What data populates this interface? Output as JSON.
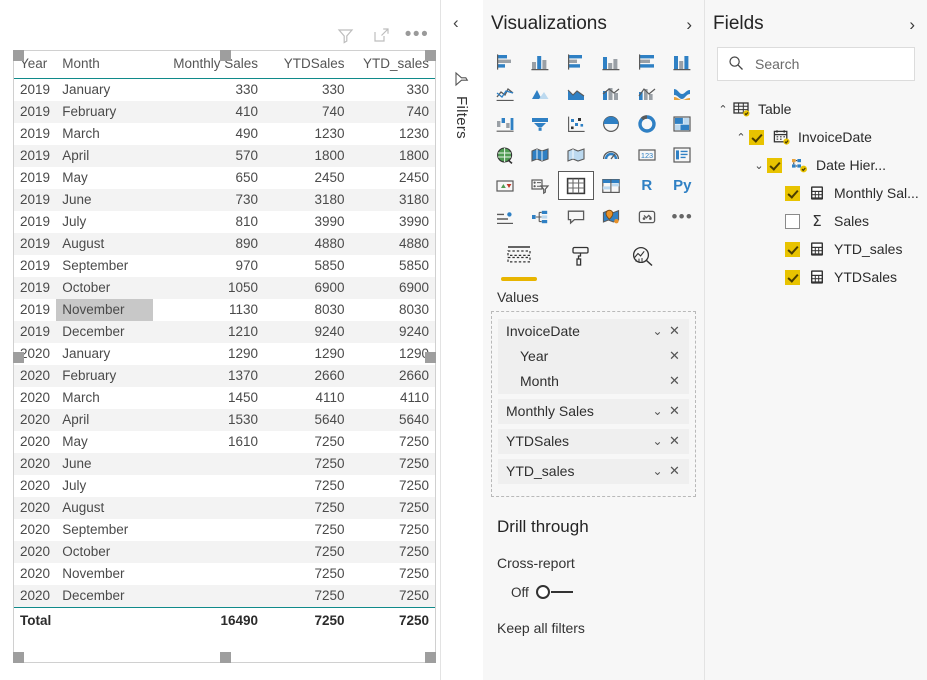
{
  "canvas": {
    "toolbar": [
      {
        "name": "filter-icon",
        "title": "Filters"
      },
      {
        "name": "focus-mode-icon",
        "title": "Focus mode"
      },
      {
        "name": "more-options-icon",
        "title": "More options",
        "glyph": "•••"
      }
    ]
  },
  "table_visual": {
    "columns": [
      {
        "key": "year",
        "label": "Year",
        "align": "left"
      },
      {
        "key": "month",
        "label": "Month",
        "align": "left"
      },
      {
        "key": "monthly_sales",
        "label": "Monthly Sales",
        "align": "right"
      },
      {
        "key": "ytdsales",
        "label": "YTDSales",
        "align": "right"
      },
      {
        "key": "ytd_sales",
        "label": "YTD_sales",
        "align": "right"
      }
    ],
    "rows": [
      {
        "year": "2019",
        "month": "January",
        "monthly_sales": "330",
        "ytdsales": "330",
        "ytd_sales": "330"
      },
      {
        "year": "2019",
        "month": "February",
        "monthly_sales": "410",
        "ytdsales": "740",
        "ytd_sales": "740"
      },
      {
        "year": "2019",
        "month": "March",
        "monthly_sales": "490",
        "ytdsales": "1230",
        "ytd_sales": "1230"
      },
      {
        "year": "2019",
        "month": "April",
        "monthly_sales": "570",
        "ytdsales": "1800",
        "ytd_sales": "1800"
      },
      {
        "year": "2019",
        "month": "May",
        "monthly_sales": "650",
        "ytdsales": "2450",
        "ytd_sales": "2450"
      },
      {
        "year": "2019",
        "month": "June",
        "monthly_sales": "730",
        "ytdsales": "3180",
        "ytd_sales": "3180"
      },
      {
        "year": "2019",
        "month": "July",
        "monthly_sales": "810",
        "ytdsales": "3990",
        "ytd_sales": "3990"
      },
      {
        "year": "2019",
        "month": "August",
        "monthly_sales": "890",
        "ytdsales": "4880",
        "ytd_sales": "4880"
      },
      {
        "year": "2019",
        "month": "September",
        "monthly_sales": "970",
        "ytdsales": "5850",
        "ytd_sales": "5850"
      },
      {
        "year": "2019",
        "month": "October",
        "monthly_sales": "1050",
        "ytdsales": "6900",
        "ytd_sales": "6900"
      },
      {
        "year": "2019",
        "month": "November",
        "monthly_sales": "1130",
        "ytdsales": "8030",
        "ytd_sales": "8030",
        "hover": true
      },
      {
        "year": "2019",
        "month": "December",
        "monthly_sales": "1210",
        "ytdsales": "9240",
        "ytd_sales": "9240"
      },
      {
        "year": "2020",
        "month": "January",
        "monthly_sales": "1290",
        "ytdsales": "1290",
        "ytd_sales": "1290"
      },
      {
        "year": "2020",
        "month": "February",
        "monthly_sales": "1370",
        "ytdsales": "2660",
        "ytd_sales": "2660"
      },
      {
        "year": "2020",
        "month": "March",
        "monthly_sales": "1450",
        "ytdsales": "4110",
        "ytd_sales": "4110"
      },
      {
        "year": "2020",
        "month": "April",
        "monthly_sales": "1530",
        "ytdsales": "5640",
        "ytd_sales": "5640"
      },
      {
        "year": "2020",
        "month": "May",
        "monthly_sales": "1610",
        "ytdsales": "7250",
        "ytd_sales": "7250"
      },
      {
        "year": "2020",
        "month": "June",
        "monthly_sales": "",
        "ytdsales": "7250",
        "ytd_sales": "7250"
      },
      {
        "year": "2020",
        "month": "July",
        "monthly_sales": "",
        "ytdsales": "7250",
        "ytd_sales": "7250"
      },
      {
        "year": "2020",
        "month": "August",
        "monthly_sales": "",
        "ytdsales": "7250",
        "ytd_sales": "7250"
      },
      {
        "year": "2020",
        "month": "September",
        "monthly_sales": "",
        "ytdsales": "7250",
        "ytd_sales": "7250"
      },
      {
        "year": "2020",
        "month": "October",
        "monthly_sales": "",
        "ytdsales": "7250",
        "ytd_sales": "7250"
      },
      {
        "year": "2020",
        "month": "November",
        "monthly_sales": "",
        "ytdsales": "7250",
        "ytd_sales": "7250"
      },
      {
        "year": "2020",
        "month": "December",
        "monthly_sales": "",
        "ytdsales": "7250",
        "ytd_sales": "7250"
      }
    ],
    "total": {
      "year": "Total",
      "month": "",
      "monthly_sales": "16490",
      "ytdsales": "7250",
      "ytd_sales": "7250"
    },
    "accent_color": "#108a8a",
    "alt_row_color": "#f3f3f3",
    "hover_cell_color": "#c8c8c8"
  },
  "filters_pane": {
    "label": "Filters",
    "collapse_glyph": "‹"
  },
  "visualizations_pane": {
    "title": "Visualizations",
    "expand_glyph": "›",
    "icons": [
      {
        "name": "stacked-bar-chart-icon"
      },
      {
        "name": "stacked-column-chart-icon"
      },
      {
        "name": "clustered-bar-chart-icon"
      },
      {
        "name": "clustered-column-chart-icon"
      },
      {
        "name": "100-stacked-bar-chart-icon"
      },
      {
        "name": "100-stacked-column-chart-icon"
      },
      {
        "name": "line-chart-icon"
      },
      {
        "name": "area-chart-icon"
      },
      {
        "name": "stacked-area-chart-icon"
      },
      {
        "name": "line-stacked-column-chart-icon"
      },
      {
        "name": "line-clustered-column-chart-icon"
      },
      {
        "name": "ribbon-chart-icon"
      },
      {
        "name": "waterfall-chart-icon"
      },
      {
        "name": "funnel-chart-icon"
      },
      {
        "name": "scatter-chart-icon"
      },
      {
        "name": "pie-chart-icon"
      },
      {
        "name": "donut-chart-icon"
      },
      {
        "name": "treemap-icon"
      },
      {
        "name": "map-icon"
      },
      {
        "name": "filled-map-icon"
      },
      {
        "name": "shape-map-icon"
      },
      {
        "name": "gauge-icon"
      },
      {
        "name": "card-icon"
      },
      {
        "name": "multi-row-card-icon"
      },
      {
        "name": "kpi-icon"
      },
      {
        "name": "slicer-icon"
      },
      {
        "name": "table-icon",
        "selected": true
      },
      {
        "name": "matrix-icon"
      },
      {
        "name": "r-script-visual-icon",
        "text": "R"
      },
      {
        "name": "python-visual-icon",
        "text": "Py"
      },
      {
        "name": "key-influencers-icon"
      },
      {
        "name": "decomposition-tree-icon"
      },
      {
        "name": "qa-visual-icon"
      },
      {
        "name": "arcgis-maps-icon"
      },
      {
        "name": "paginated-report-icon"
      },
      {
        "name": "get-more-visuals-icon",
        "glyph": "•••"
      }
    ],
    "format_tabs": [
      {
        "name": "fields-tab",
        "icon": "fields-icon",
        "active": true
      },
      {
        "name": "format-tab",
        "icon": "paint-roller-icon",
        "active": false
      },
      {
        "name": "analytics-tab",
        "icon": "analytics-magnifier-icon",
        "active": false
      }
    ],
    "values_label": "Values",
    "wells": [
      {
        "name": "InvoiceDate",
        "has_dropdown": true,
        "children": [
          {
            "name": "Year"
          },
          {
            "name": "Month"
          }
        ]
      },
      {
        "name": "Monthly Sales",
        "has_dropdown": true,
        "children": []
      },
      {
        "name": "YTDSales",
        "has_dropdown": true,
        "children": []
      },
      {
        "name": "YTD_sales",
        "has_dropdown": true,
        "children": []
      }
    ],
    "drill_through": {
      "title": "Drill through",
      "cross_report_label": "Cross-report",
      "toggle_state": "Off",
      "keep_all_filters_label": "Keep all filters"
    }
  },
  "fields_pane": {
    "title": "Fields",
    "expand_glyph": "›",
    "search": {
      "placeholder": "Search",
      "value": ""
    },
    "tree": [
      {
        "label": "Table",
        "indent": 0,
        "expander": "⌃",
        "checkbox": "none",
        "icon": "table-data-icon"
      },
      {
        "label": "InvoiceDate",
        "indent": 1,
        "expander": "⌃",
        "checkbox": "checked",
        "icon": "calendar-icon"
      },
      {
        "label": "Date Hier...",
        "indent": 2,
        "expander": "⌄",
        "checkbox": "checked",
        "icon": "hierarchy-icon"
      },
      {
        "label": "Monthly Sal...",
        "indent": 3,
        "expander": "",
        "checkbox": "checked",
        "icon": "measure-icon"
      },
      {
        "label": "Sales",
        "indent": 3,
        "expander": "",
        "checkbox": "unchecked",
        "icon": "sigma-icon"
      },
      {
        "label": "YTD_sales",
        "indent": 3,
        "expander": "",
        "checkbox": "checked",
        "icon": "measure-icon"
      },
      {
        "label": "YTDSales",
        "indent": 3,
        "expander": "",
        "checkbox": "checked",
        "icon": "measure-icon"
      }
    ]
  }
}
